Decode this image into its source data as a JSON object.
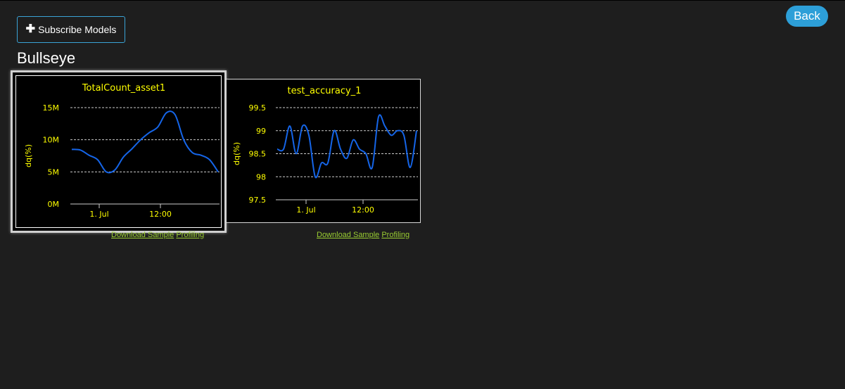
{
  "header": {
    "subscribe_label": "Subscribe Models",
    "back_label": "Back"
  },
  "page": {
    "title": "Bullseye"
  },
  "charts": [
    {
      "download_label": "Download Sample",
      "profiling_label": "Profiling"
    },
    {
      "download_label": "Download Sample",
      "profiling_label": "Profiling"
    }
  ],
  "colors": {
    "accent": "#2d9fd8",
    "series": "#1565e8",
    "chart_text": "#ffff00",
    "link": "#9acd32"
  },
  "chart_data": [
    {
      "type": "line",
      "title": "TotalCount_asset1",
      "ylabel": "dq(%)",
      "xlabel": "",
      "x_ticks": [
        "1. Jul",
        "12:00"
      ],
      "y_ticks": [
        "0M",
        "5M",
        "10M",
        "15M"
      ],
      "ylim": [
        0,
        15000000
      ],
      "series": [
        {
          "values": [
            8500000,
            8400000,
            7600000,
            6900000,
            5000000,
            5300000,
            7300000,
            8600000,
            10000000,
            11100000,
            12000000,
            14200000,
            13900000,
            10000000,
            8000000,
            7600000,
            6900000,
            5000000
          ]
        }
      ]
    },
    {
      "type": "line",
      "title": "test_accuracy_1",
      "ylabel": "dq(%)",
      "xlabel": "",
      "x_ticks": [
        "1. Jul",
        "12:00"
      ],
      "y_ticks": [
        "97.5",
        "98",
        "98.5",
        "99",
        "99.5"
      ],
      "ylim": [
        97.5,
        99.5
      ],
      "series": [
        {
          "values": [
            98.6,
            98.6,
            99.1,
            98.5,
            99.1,
            98.9,
            98.0,
            98.3,
            98.3,
            99.0,
            98.6,
            98.4,
            98.8,
            98.6,
            98.5,
            98.2,
            99.3,
            99.1,
            98.9,
            99.0,
            98.9,
            98.2,
            99.0
          ]
        }
      ]
    }
  ]
}
